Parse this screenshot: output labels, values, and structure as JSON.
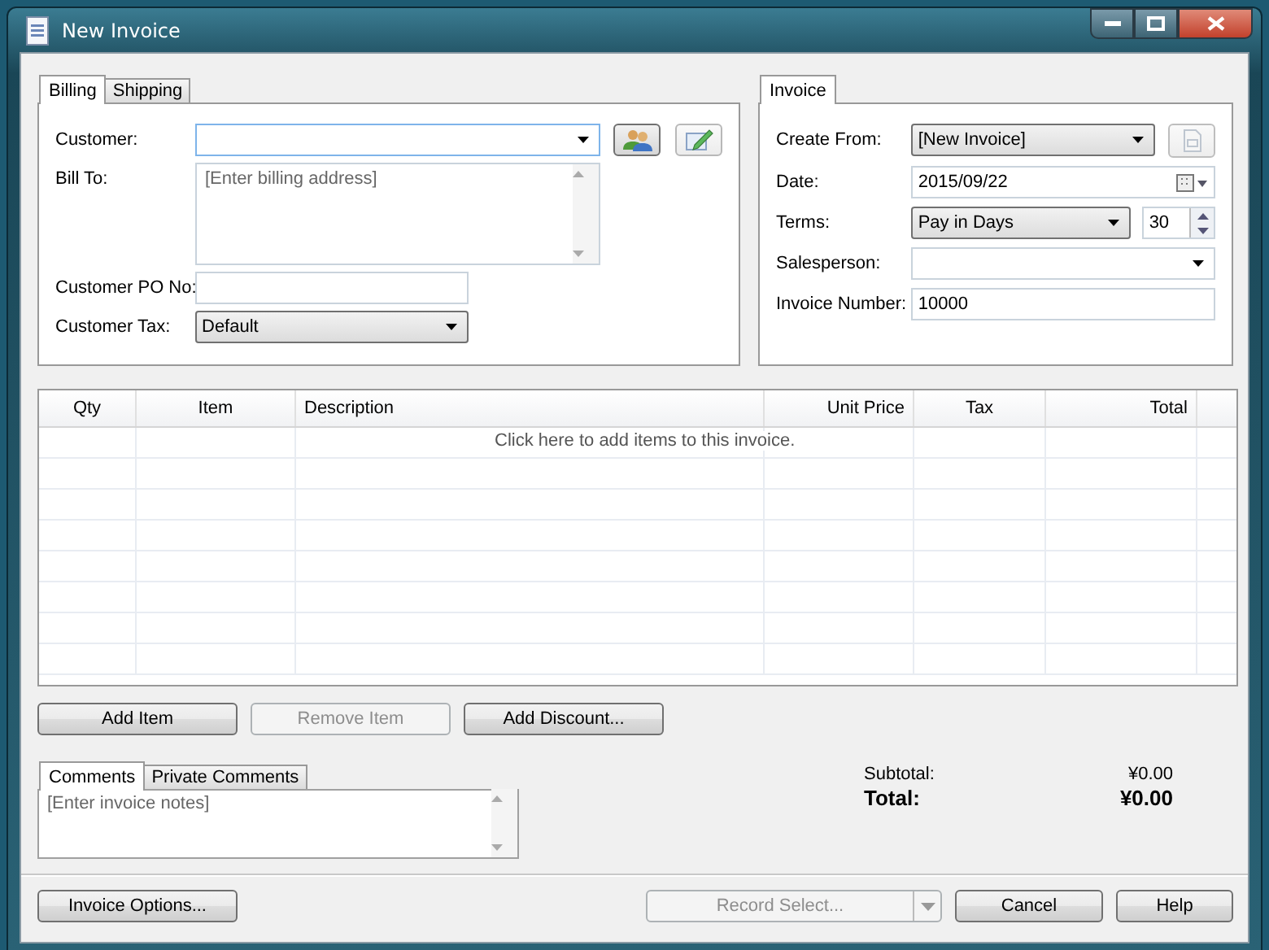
{
  "window": {
    "title": "New Invoice"
  },
  "billing": {
    "tabs": [
      {
        "label": "Billing",
        "selected": true
      },
      {
        "label": "Shipping",
        "selected": false
      }
    ],
    "fields": [
      {
        "kind": "customer",
        "label": "Customer:"
      },
      {
        "kind": "textarea",
        "label": "Bill To:",
        "placeholder": "[Enter billing address]"
      },
      {
        "kind": "text",
        "label": "Customer PO No:"
      },
      {
        "kind": "select",
        "label": "Customer Tax:",
        "value": "Default"
      }
    ]
  },
  "invoice": {
    "tabs": [
      {
        "label": "Invoice",
        "selected": true
      }
    ],
    "fields": [
      {
        "kind": "template",
        "label": "Create From:",
        "value": "[New Invoice]"
      },
      {
        "kind": "date",
        "label": "Date:",
        "value": "2015/09/22"
      },
      {
        "kind": "terms",
        "label": "Terms:",
        "value": "Pay in Days",
        "days": "30"
      },
      {
        "kind": "combo",
        "label": "Salesperson:"
      },
      {
        "kind": "text",
        "label": "Invoice Number:",
        "value": "10000"
      }
    ]
  },
  "table": {
    "columns": [
      {
        "label": "Qty"
      },
      {
        "label": "Item"
      },
      {
        "label": "Description"
      },
      {
        "label": "Unit Price"
      },
      {
        "label": "Tax"
      },
      {
        "label": "Total"
      }
    ],
    "hint": "Click here to add items to this invoice."
  },
  "item_buttons": [
    {
      "label": "Add Item",
      "disabled": false
    },
    {
      "label": "Remove Item",
      "disabled": true
    },
    {
      "label": "Add Discount...",
      "disabled": false
    }
  ],
  "comments": {
    "tabs": [
      {
        "label": "Comments",
        "selected": true
      },
      {
        "label": "Private Comments",
        "selected": false
      }
    ],
    "placeholder": "[Enter invoice notes]"
  },
  "totals": [
    {
      "label": "Subtotal:",
      "value": "¥0.00",
      "bold": false
    },
    {
      "label": "Total:",
      "value": "¥0.00",
      "bold": true
    }
  ],
  "footer": {
    "options": "Invoice Options...",
    "record_select": {
      "label": "Record Select...",
      "disabled": true
    },
    "cancel": "Cancel",
    "help": "Help"
  }
}
